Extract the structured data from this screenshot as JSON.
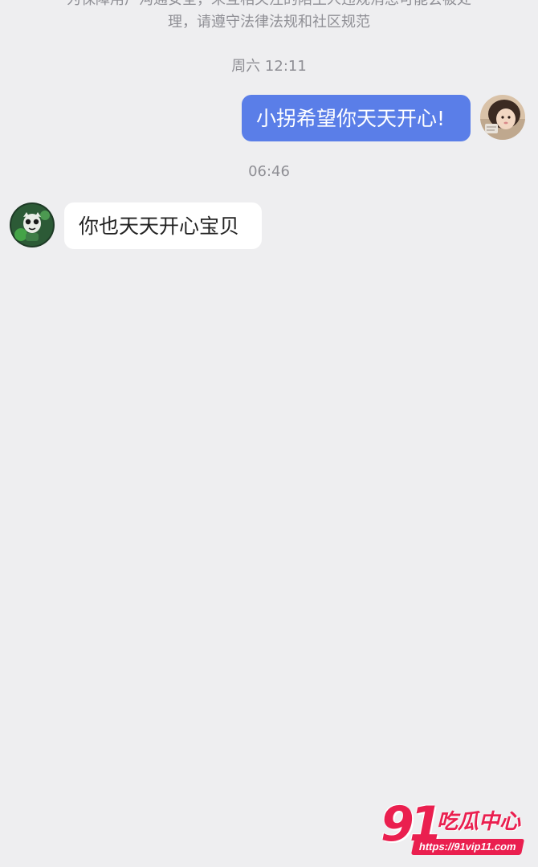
{
  "notice": {
    "line1": "为保障用户沟通安全，未互相关注的陌生人违规消息可能会被处",
    "line2": "理，请遵守法律法规和社区规范"
  },
  "messages": [
    {
      "timestamp": "周六 12:11",
      "sender": "me",
      "text": "小拐希望你天天开心!"
    },
    {
      "timestamp": "06:46",
      "sender": "other",
      "text": "你也天天开心宝贝"
    }
  ],
  "watermark": {
    "logo": "91",
    "name": "吃瓜中心",
    "url": "https://91vip11.com"
  },
  "colors": {
    "background": "#eeeef0",
    "bubble_me": "#5a7ee8",
    "bubble_other": "#ffffff",
    "meta_text": "#8f8f95",
    "watermark": "#ea1f4f"
  },
  "icons": {
    "my_avatar": "girl-portrait-avatar",
    "other_avatar": "green-cartoon-avatar"
  }
}
